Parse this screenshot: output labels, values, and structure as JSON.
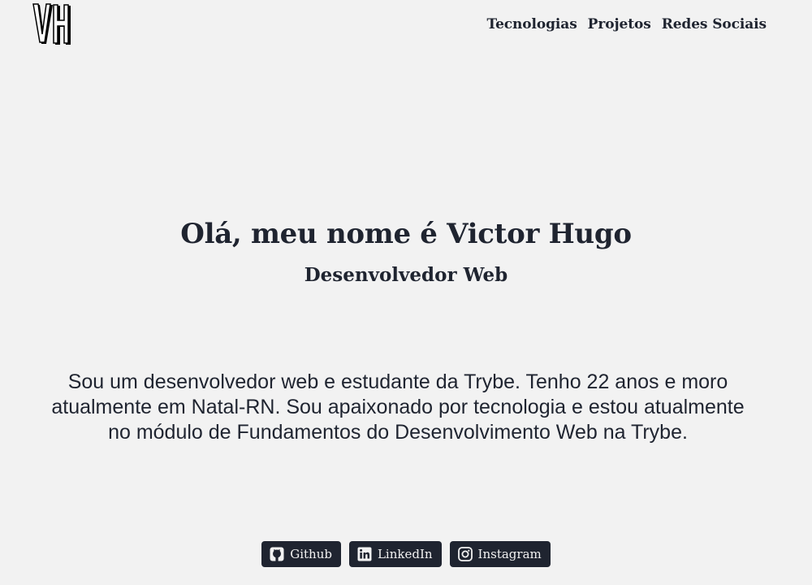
{
  "header": {
    "logo_text": "VH",
    "nav": [
      {
        "label": "Tecnologias"
      },
      {
        "label": "Projetos"
      },
      {
        "label": "Redes Sociais"
      }
    ]
  },
  "hero": {
    "title": "Olá, meu nome é Victor Hugo",
    "subtitle": "Desenvolvedor Web"
  },
  "about": {
    "text": "Sou um desenvolvedor web e estudante da Trybe. Tenho 22 anos e moro atualmente em Natal-RN. Sou apaixonado por tecnologia e estou atualmente no módulo de Fundamentos do Desenvolvimento Web na Trybe."
  },
  "socials": [
    {
      "label": "Github",
      "icon": "github-icon"
    },
    {
      "label": "LinkedIn",
      "icon": "linkedin-icon"
    },
    {
      "label": "Instagram",
      "icon": "instagram-icon"
    }
  ],
  "colors": {
    "background": "#f2f2f2",
    "text": "#1f2430",
    "button_bg": "#1f2430"
  }
}
